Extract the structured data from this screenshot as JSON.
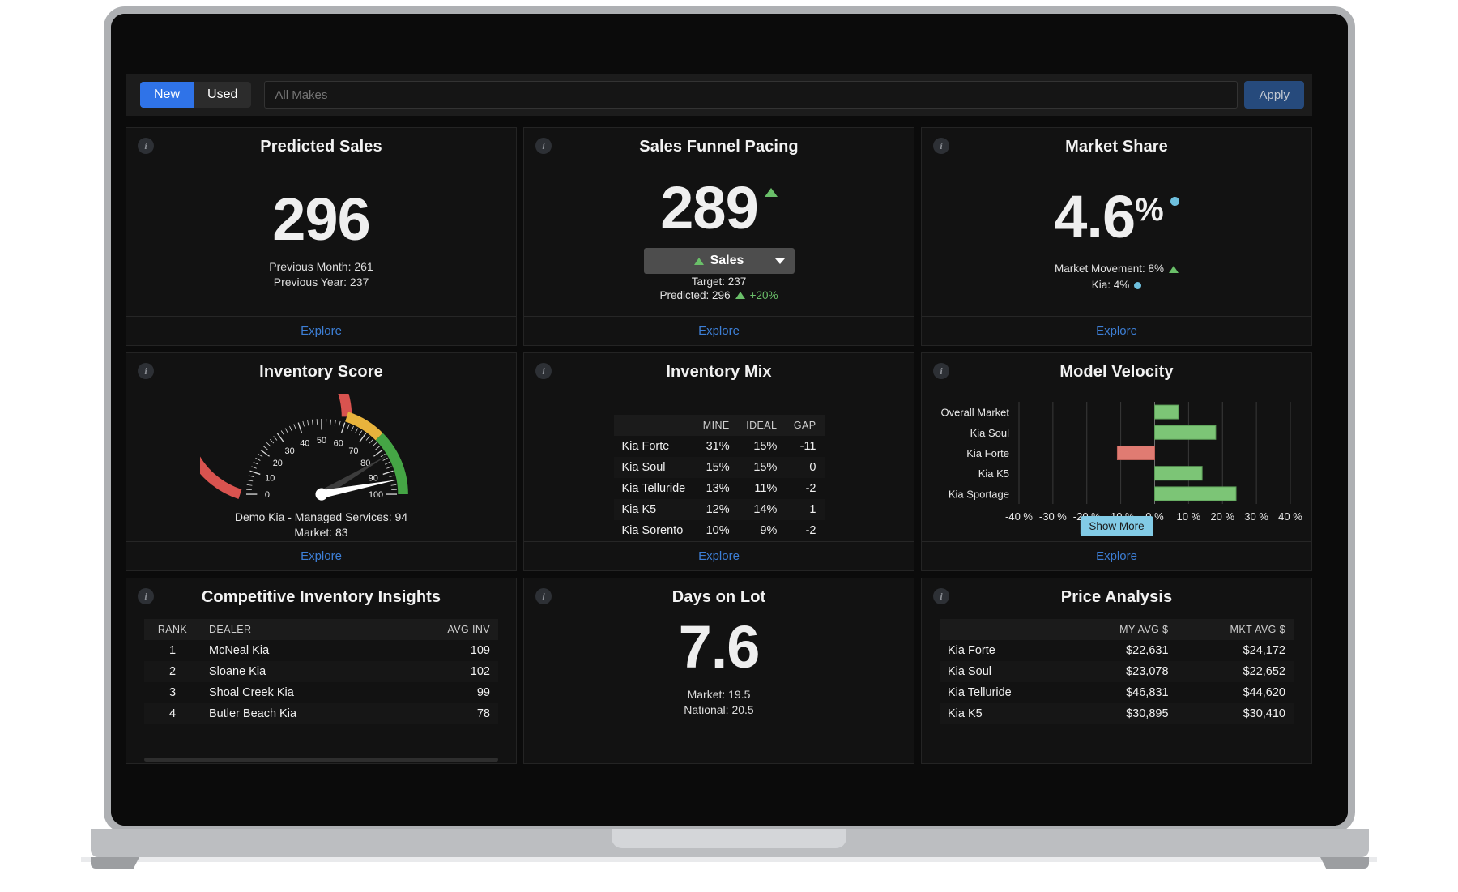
{
  "filter_bar": {
    "condition_options": [
      "New",
      "Used"
    ],
    "condition_selected": "New",
    "makes_value": "",
    "makes_placeholder": "All Makes",
    "apply_label": "Apply"
  },
  "cards": {
    "predicted_sales": {
      "title": "Predicted Sales",
      "value": "296",
      "previous_month": "Previous Month: 261",
      "previous_year": "Previous Year: 237",
      "explore": "Explore"
    },
    "sales_funnel_pacing": {
      "title": "Sales Funnel Pacing",
      "value": "289",
      "trend": "up",
      "selector_label": "Sales",
      "target": "Target: 237",
      "predicted": "Predicted: 296",
      "delta": "+20%",
      "explore": "Explore"
    },
    "market_share": {
      "title": "Market Share",
      "value": "4.6",
      "unit": "%",
      "market_movement": "Market Movement: 8%",
      "kia": "Kia: 4%",
      "explore": "Explore"
    },
    "inventory_score": {
      "title": "Inventory Score",
      "dealer_line": "Demo Kia - Managed Services: 94",
      "market_line": "Market: 83",
      "explore": "Explore"
    },
    "inventory_mix": {
      "title": "Inventory Mix",
      "columns": [
        "",
        "MINE",
        "IDEAL",
        "GAP"
      ],
      "rows": [
        {
          "model": "Kia Forte",
          "mine": "31%",
          "ideal": "15%",
          "gap": "-11",
          "gap_tone": "neg"
        },
        {
          "model": "Kia Soul",
          "mine": "15%",
          "ideal": "15%",
          "gap": "0",
          "gap_tone": "grn"
        },
        {
          "model": "Kia Telluride",
          "mine": "13%",
          "ideal": "11%",
          "gap": "-2",
          "gap_tone": "neg"
        },
        {
          "model": "Kia K5",
          "mine": "12%",
          "ideal": "14%",
          "gap": "1",
          "gap_tone": "blu"
        },
        {
          "model": "Kia Sorento",
          "mine": "10%",
          "ideal": "9%",
          "gap": "-2",
          "gap_tone": "blu"
        }
      ],
      "explore": "Explore"
    },
    "model_velocity": {
      "title": "Model Velocity",
      "show_more_label": "Show More",
      "explore": "Explore"
    },
    "competitive_inventory_insights": {
      "title": "Competitive Inventory Insights",
      "columns": [
        "RANK",
        "DEALER",
        "AVG INV"
      ],
      "rows": [
        {
          "rank": "1",
          "dealer": "McNeal Kia",
          "avg_inv": "109"
        },
        {
          "rank": "2",
          "dealer": "Sloane Kia",
          "avg_inv": "102"
        },
        {
          "rank": "3",
          "dealer": "Shoal Creek Kia",
          "avg_inv": "99"
        },
        {
          "rank": "4",
          "dealer": "Butler Beach Kia",
          "avg_inv": "78"
        }
      ]
    },
    "days_on_lot": {
      "title": "Days on Lot",
      "value": "7.6",
      "market": "Market: 19.5",
      "national": "National: 20.5"
    },
    "price_analysis": {
      "title": "Price Analysis",
      "columns": [
        "",
        "MY AVG $",
        "MKT AVG $"
      ],
      "rows": [
        {
          "model": "Kia Forte",
          "my_avg": "$22,631",
          "my_tone": "grn",
          "mkt_avg": "$24,172"
        },
        {
          "model": "Kia Soul",
          "my_avg": "$23,078",
          "my_tone": "neg",
          "mkt_avg": "$22,652"
        },
        {
          "model": "Kia Telluride",
          "my_avg": "$46,831",
          "my_tone": "neg",
          "mkt_avg": "$44,620"
        },
        {
          "model": "Kia K5",
          "my_avg": "$30,895",
          "my_tone": "neg",
          "mkt_avg": "$30,410"
        }
      ]
    }
  },
  "chart_data": [
    {
      "type": "gauge",
      "title": "Inventory Score",
      "min": 0,
      "max": 100,
      "tick_labels": [
        "0",
        "10",
        "20",
        "30",
        "40",
        "50",
        "60",
        "70",
        "80",
        "90",
        "100"
      ],
      "needles": [
        {
          "name": "Demo Kia - Managed Services",
          "value": 94,
          "color": "#ffffff"
        },
        {
          "name": "Market",
          "value": 83,
          "color": "#3c3c3c"
        }
      ],
      "bands": [
        {
          "from": 0,
          "to": 60,
          "color": "#d9534f"
        },
        {
          "from": 60,
          "to": 75,
          "color": "#e8b33c"
        },
        {
          "from": 75,
          "to": 100,
          "color": "#45a545"
        }
      ]
    },
    {
      "type": "bar",
      "orientation": "horizontal",
      "title": "Model Velocity",
      "categories": [
        "Overall Market",
        "Kia Soul",
        "Kia Forte",
        "Kia K5",
        "Kia Sportage"
      ],
      "values": [
        7,
        18,
        -11,
        14,
        24
      ],
      "xlabel": "",
      "ylabel": "",
      "xlim": [
        -40,
        40
      ],
      "xticks": [
        -40,
        -30,
        -20,
        -10,
        0,
        10,
        20,
        30,
        40
      ],
      "xtick_labels": [
        "-40 %",
        "-30 %",
        "-20 %",
        "-10 %",
        "0 %",
        "10 %",
        "20 %",
        "30 %",
        "40 %"
      ],
      "grid": true,
      "legend": "none",
      "colors": {
        "positive": "#7cc576",
        "negative": "#e07b72"
      }
    },
    {
      "type": "table",
      "title": "Inventory Mix",
      "columns": [
        "",
        "MINE",
        "IDEAL",
        "GAP"
      ],
      "rows": [
        [
          "Kia Forte",
          "31%",
          "15%",
          "-11"
        ],
        [
          "Kia Soul",
          "15%",
          "15%",
          "0"
        ],
        [
          "Kia Telluride",
          "13%",
          "11%",
          "-2"
        ],
        [
          "Kia K5",
          "12%",
          "14%",
          "1"
        ],
        [
          "Kia Sorento",
          "10%",
          "9%",
          "-2"
        ]
      ]
    },
    {
      "type": "table",
      "title": "Competitive Inventory Insights",
      "columns": [
        "RANK",
        "DEALER",
        "AVG INV"
      ],
      "rows": [
        [
          "1",
          "McNeal Kia",
          "109"
        ],
        [
          "2",
          "Sloane Kia",
          "102"
        ],
        [
          "3",
          "Shoal Creek Kia",
          "99"
        ],
        [
          "4",
          "Butler Beach Kia",
          "78"
        ]
      ]
    },
    {
      "type": "table",
      "title": "Price Analysis",
      "columns": [
        "",
        "MY AVG $",
        "MKT AVG $"
      ],
      "rows": [
        [
          "Kia Forte",
          "$22,631",
          "$24,172"
        ],
        [
          "Kia Soul",
          "$23,078",
          "$22,652"
        ],
        [
          "Kia Telluride",
          "$46,831",
          "$44,620"
        ],
        [
          "Kia K5",
          "$30,895",
          "$30,410"
        ]
      ]
    }
  ]
}
